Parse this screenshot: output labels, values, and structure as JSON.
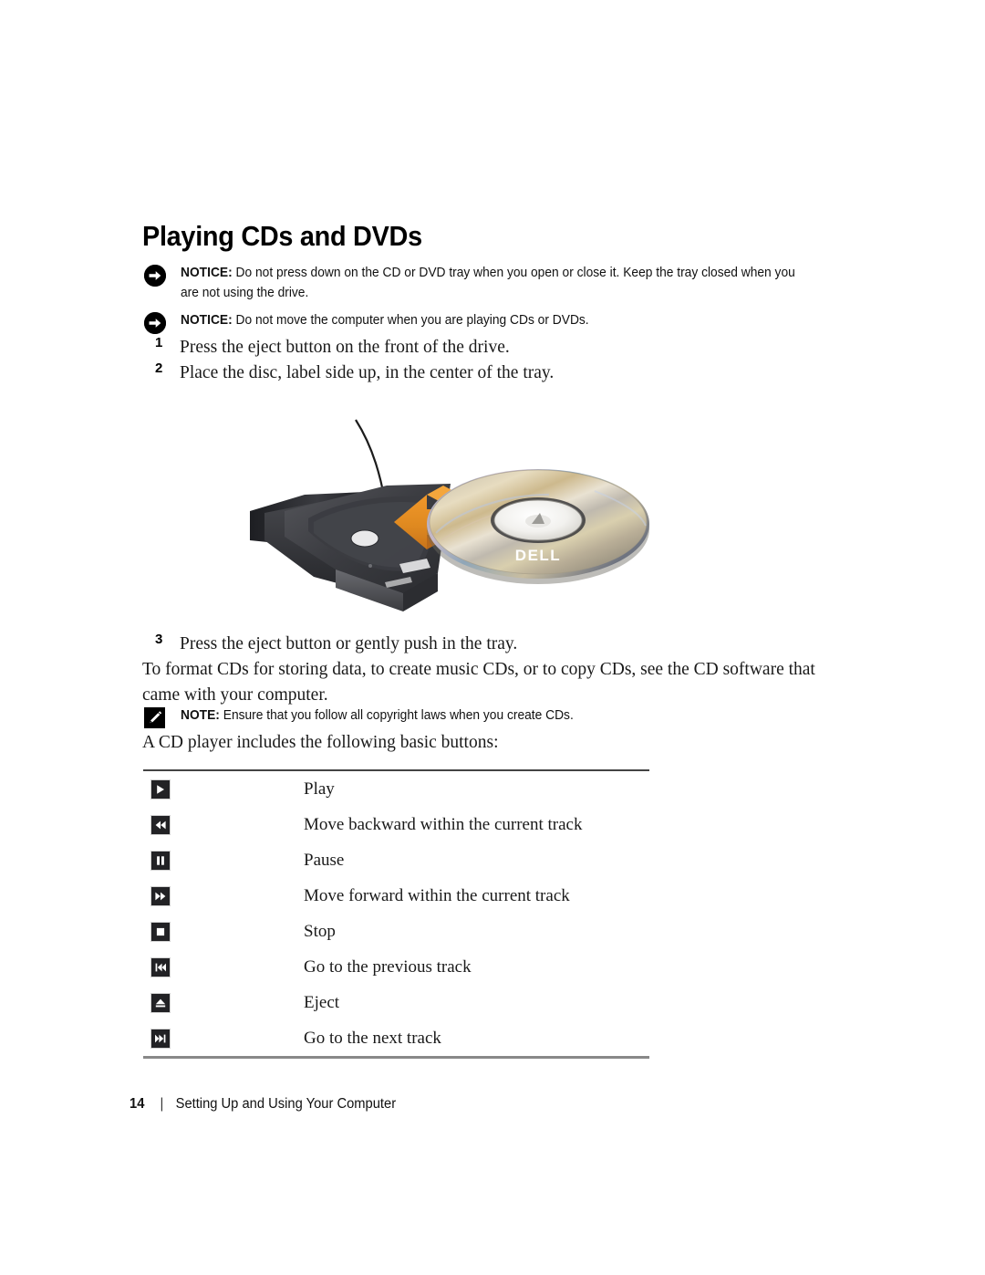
{
  "heading": "Playing CDs and DVDs",
  "notices": [
    {
      "icon": "notice-arrow-icon",
      "label": "NOTICE:",
      "text": " Do not press down on the CD or DVD tray when you open or close it. Keep the tray closed when you are not using the drive."
    },
    {
      "icon": "notice-arrow-icon",
      "label": "NOTICE:",
      "text": " Do not move the computer when you are playing CDs or DVDs."
    }
  ],
  "steps": [
    {
      "num": "1",
      "text": "Press the eject button on the front of the drive."
    },
    {
      "num": "2",
      "text": "Place the disc, label side up, in the center of the tray."
    },
    {
      "num": "3",
      "text": "Press the eject button or gently push in the tray."
    }
  ],
  "figure": {
    "name": "cd-tray-with-disc-illustration",
    "disc_label": "DELL",
    "arrow_color": "#e08a20"
  },
  "paragraph": "To format CDs for storing data, to create music CDs, or to copy CDs, see the CD software that came with your computer.",
  "note": {
    "icon": "note-pencil-icon",
    "label": "NOTE:",
    "text": " Ensure that you follow all copyright laws when you create CDs."
  },
  "table_intro": "A CD player includes the following basic buttons:",
  "buttons_table": {
    "rows": [
      {
        "icon": "play-icon",
        "label": "Play"
      },
      {
        "icon": "rewind-icon",
        "label": "Move backward within the current track"
      },
      {
        "icon": "pause-icon",
        "label": "Pause"
      },
      {
        "icon": "fast-forward-icon",
        "label": "Move forward within the current track"
      },
      {
        "icon": "stop-icon",
        "label": "Stop"
      },
      {
        "icon": "previous-track-icon",
        "label": "Go to the previous track"
      },
      {
        "icon": "eject-icon",
        "label": "Eject"
      },
      {
        "icon": "next-track-icon",
        "label": "Go to the next track"
      }
    ]
  },
  "footer": {
    "page_number": "14",
    "separator": "|",
    "section_title": "Setting Up and Using Your Computer"
  }
}
